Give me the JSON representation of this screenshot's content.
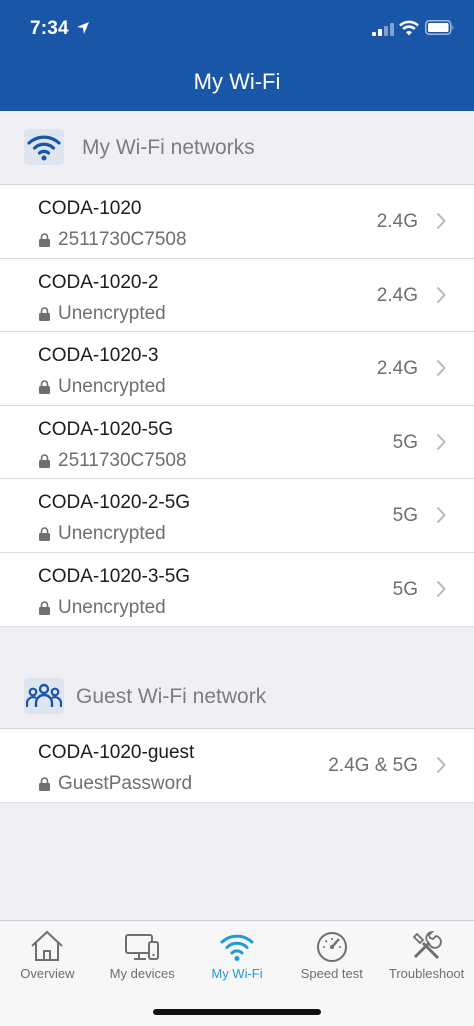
{
  "status_bar": {
    "time": "7:34"
  },
  "header": {
    "title": "My Wi-Fi"
  },
  "sections": {
    "my_networks": {
      "title": "My Wi-Fi networks",
      "icon": "wifi-icon"
    },
    "guest": {
      "title": "Guest Wi-Fi network",
      "icon": "people-group-icon"
    }
  },
  "networks": [
    {
      "name": "CODA-1020",
      "security": "2511730C7508",
      "band": "2.4G"
    },
    {
      "name": "CODA-1020-2",
      "security": "Unencrypted",
      "band": "2.4G"
    },
    {
      "name": "CODA-1020-3",
      "security": "Unencrypted",
      "band": "2.4G"
    },
    {
      "name": "CODA-1020-5G",
      "security": "2511730C7508",
      "band": "5G"
    },
    {
      "name": "CODA-1020-2-5G",
      "security": "Unencrypted",
      "band": "5G"
    },
    {
      "name": "CODA-1020-3-5G",
      "security": "Unencrypted",
      "band": "5G"
    }
  ],
  "guest_networks": [
    {
      "name": "CODA-1020-guest",
      "security": "GuestPassword",
      "band": "2.4G & 5G"
    }
  ],
  "tabbar": {
    "active": "My Wi-Fi",
    "tabs": [
      {
        "label": "Overview",
        "icon": "home-icon"
      },
      {
        "label": "My devices",
        "icon": "devices-icon"
      },
      {
        "label": "My Wi-Fi",
        "icon": "wifi-icon"
      },
      {
        "label": "Speed test",
        "icon": "speedometer-icon"
      },
      {
        "label": "Troubleshoot",
        "icon": "tools-icon"
      }
    ]
  },
  "colors": {
    "header": "#1a56a8",
    "accent": "#1e9bd8",
    "background": "#efeff4"
  }
}
